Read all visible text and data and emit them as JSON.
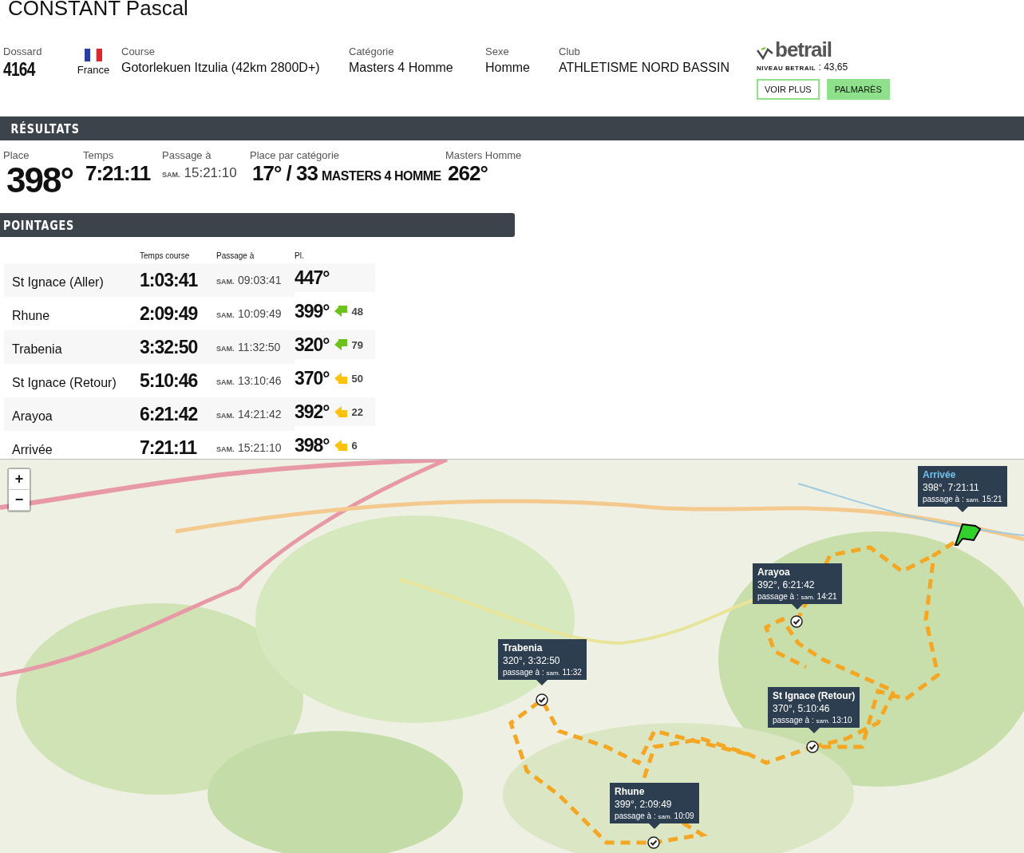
{
  "athlete": {
    "name": "CONSTANT Pascal"
  },
  "info": [
    {
      "kind": "bib",
      "label": "Dossard",
      "value": "4164"
    },
    {
      "kind": "flag",
      "value": "France"
    },
    {
      "kind": "text",
      "label": "Course",
      "value": "Gotorlekuen Itzulia (42km 2800D+)"
    },
    {
      "kind": "text",
      "label": "Catégorie",
      "value": "Masters 4 Homme"
    },
    {
      "kind": "text",
      "label": "Sexe",
      "value": "Homme"
    },
    {
      "kind": "text",
      "label": "Club",
      "value": "ATHLETISME NORD BASSIN"
    }
  ],
  "betrail": {
    "logo": "betrail",
    "level_label": "NIVEAU BETRAIL",
    "level_value": ": 43,65",
    "buttons": [
      {
        "label": "VOIR PLUS",
        "kind": "outline"
      },
      {
        "label": "PALMARÈS",
        "kind": "filled"
      }
    ]
  },
  "results": {
    "title": "RÉSULTATS",
    "items": [
      {
        "kind": "place",
        "label": "Place",
        "value": "398°"
      },
      {
        "kind": "time",
        "label": "Temps",
        "value": "7:21:11"
      },
      {
        "kind": "passage",
        "label": "Passage à",
        "day": "SAM.",
        "value": "15:21:10"
      },
      {
        "kind": "category",
        "label": "Place par catégorie",
        "value": "17° / 33",
        "suffix": "MASTERS 4 HOMME"
      },
      {
        "kind": "time",
        "label": "Masters Homme",
        "value": "262°"
      }
    ]
  },
  "pointages": {
    "title": "POINTAGES",
    "columns": [
      "Temps course",
      "Passage à",
      "Pl."
    ],
    "rows": [
      {
        "name": "St Ignace (Aller)",
        "time": "1:03:41",
        "day": "SAM.",
        "passage": "09:03:41",
        "place": "447°"
      },
      {
        "name": "Rhune",
        "time": "2:09:49",
        "day": "SAM.",
        "passage": "10:09:49",
        "place": "399°",
        "improved": true,
        "delta": "48"
      },
      {
        "name": "Trabenia",
        "time": "3:32:50",
        "day": "SAM.",
        "passage": "11:32:50",
        "place": "320°",
        "improved": true,
        "delta": "79"
      },
      {
        "name": "St Ignace (Retour)",
        "time": "5:10:46",
        "day": "SAM.",
        "passage": "13:10:46",
        "place": "370°",
        "improved": false,
        "delta": "50"
      },
      {
        "name": "Arayoa",
        "time": "6:21:42",
        "day": "SAM.",
        "passage": "14:21:42",
        "place": "392°",
        "improved": false,
        "delta": "22"
      },
      {
        "name": "Arrivée",
        "time": "7:21:11",
        "day": "SAM.",
        "passage": "15:21:10",
        "place": "398°",
        "improved": false,
        "delta": "6"
      }
    ]
  },
  "map": {
    "zoom_in": "+",
    "zoom_out": "−",
    "markers": [
      {
        "kind": "finish",
        "title": "Arrivée",
        "reading": "398°, 7:21:11",
        "passage_label": "passage à :",
        "day": "sam.",
        "time": "15:21"
      },
      {
        "kind": "checkpoint",
        "title": "Arayoa",
        "reading": "392°, 6:21:42",
        "passage_label": "passage à :",
        "day": "sam.",
        "time": "14:21"
      },
      {
        "kind": "checkpoint",
        "title": "Trabenia",
        "reading": "320°, 3:32:50",
        "passage_label": "passage à :",
        "day": "sam.",
        "time": "11:32"
      },
      {
        "kind": "checkpoint",
        "title": "St Ignace (Retour)",
        "reading": "370°, 5:10:46",
        "passage_label": "passage à :",
        "day": "sam.",
        "time": "13:10"
      },
      {
        "kind": "checkpoint",
        "title": "Rhune",
        "reading": "399°, 2:09:49",
        "passage_label": "passage à :",
        "day": "sam.",
        "time": "10:09"
      }
    ]
  }
}
